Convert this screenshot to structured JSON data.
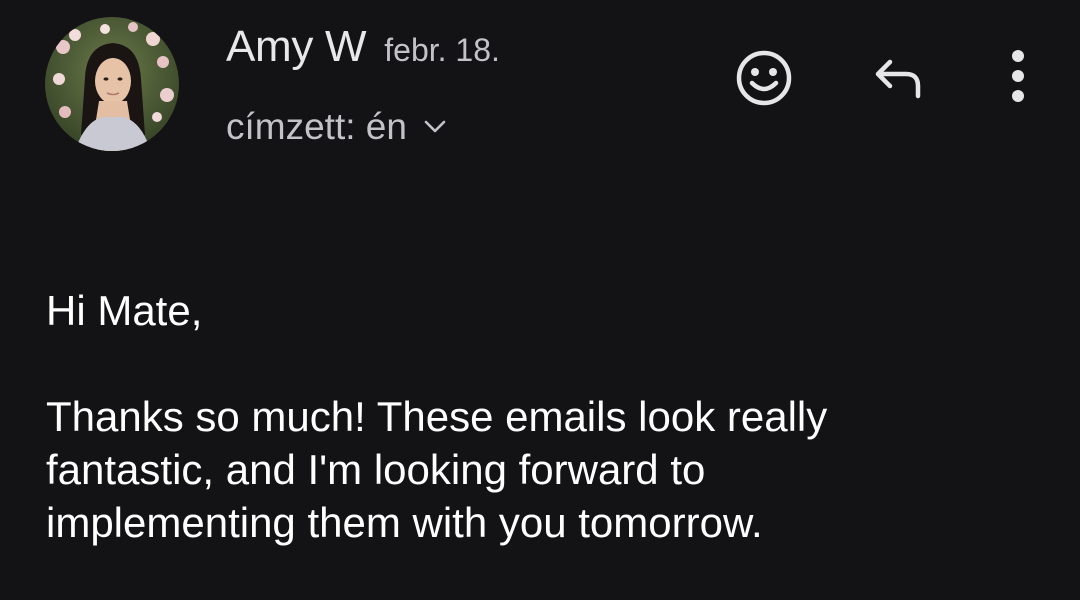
{
  "email": {
    "sender": {
      "name": "Amy W",
      "date": "febr. 18."
    },
    "recipient_label": "címzett: én",
    "actions": {
      "emoji_icon": "smiley-face-icon",
      "reply_icon": "reply-arrow-icon",
      "more_icon": "vertical-dots-icon"
    },
    "body": {
      "greeting": "Hi Mate,",
      "lines": [
        "Thanks so much! These emails look really",
        "fantastic, and I'm looking forward to",
        "implementing them with you tomorrow."
      ]
    }
  },
  "colors": {
    "background": "#131316",
    "primary_text": "#ffffff",
    "secondary_text": "#c2c2c7"
  }
}
